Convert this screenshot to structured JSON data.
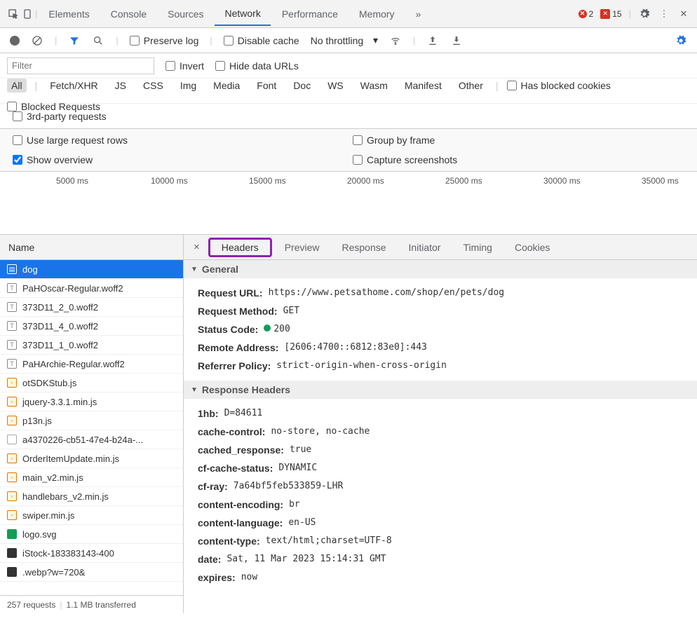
{
  "topTabs": {
    "elements": "Elements",
    "console": "Console",
    "sources": "Sources",
    "network": "Network",
    "performance": "Performance",
    "memory": "Memory"
  },
  "badges": {
    "err": "2",
    "warn": "15"
  },
  "toolbar": {
    "preserve": "Preserve log",
    "disable": "Disable cache",
    "throttle": "No throttling"
  },
  "filter": {
    "placeholder": "Filter",
    "invert": "Invert",
    "hideData": "Hide data URLs"
  },
  "types": {
    "all": "All",
    "fetch": "Fetch/XHR",
    "js": "JS",
    "css": "CSS",
    "img": "Img",
    "media": "Media",
    "font": "Font",
    "doc": "Doc",
    "ws": "WS",
    "wasm": "Wasm",
    "manifest": "Manifest",
    "other": "Other",
    "blocked": "Has blocked cookies",
    "blockedReq": "Blocked Requests"
  },
  "third": "3rd-party requests",
  "options": {
    "large": "Use large request rows",
    "group": "Group by frame",
    "overview": "Show overview",
    "capture": "Capture screenshots"
  },
  "timeline": [
    "5000 ms",
    "10000 ms",
    "15000 ms",
    "20000 ms",
    "25000 ms",
    "30000 ms",
    "35000 ms"
  ],
  "sidebar": {
    "header": "Name",
    "footer1": "257 requests",
    "footer2": "1.1 MB transferred",
    "items": [
      {
        "icon": "doc",
        "name": "dog",
        "sel": true
      },
      {
        "icon": "font",
        "name": "PaHOscar-Regular.woff2"
      },
      {
        "icon": "font",
        "name": "373D11_2_0.woff2"
      },
      {
        "icon": "font",
        "name": "373D11_4_0.woff2"
      },
      {
        "icon": "font",
        "name": "373D11_1_0.woff2"
      },
      {
        "icon": "font",
        "name": "PaHArchie-Regular.woff2"
      },
      {
        "icon": "js",
        "name": "otSDKStub.js"
      },
      {
        "icon": "js",
        "name": "jquery-3.3.1.min.js"
      },
      {
        "icon": "js",
        "name": "p13n.js"
      },
      {
        "icon": "blank",
        "name": "a4370226-cb51-47e4-b24a-..."
      },
      {
        "icon": "js",
        "name": "OrderItemUpdate.min.js"
      },
      {
        "icon": "js",
        "name": "main_v2.min.js"
      },
      {
        "icon": "js",
        "name": "handlebars_v2.min.js"
      },
      {
        "icon": "js",
        "name": "swiper.min.js"
      },
      {
        "icon": "img",
        "name": "logo.svg"
      },
      {
        "icon": "bin",
        "name": "iStock-183383143-400"
      },
      {
        "icon": "bin",
        "name": ".webp?w=720&"
      }
    ]
  },
  "detailTabs": {
    "headers": "Headers",
    "preview": "Preview",
    "response": "Response",
    "initiator": "Initiator",
    "timing": "Timing",
    "cookies": "Cookies"
  },
  "general": {
    "title": "General",
    "url_l": "Request URL:",
    "url_v": "https://www.petsathome.com/shop/en/pets/dog",
    "method_l": "Request Method:",
    "method_v": "GET",
    "status_l": "Status Code:",
    "status_v": "200",
    "remote_l": "Remote Address:",
    "remote_v": "[2606:4700::6812:83e0]:443",
    "ref_l": "Referrer Policy:",
    "ref_v": "strict-origin-when-cross-origin"
  },
  "response": {
    "title": "Response Headers",
    "h": [
      {
        "l": "1hb:",
        "v": "D=84611"
      },
      {
        "l": "cache-control:",
        "v": "no-store, no-cache"
      },
      {
        "l": "cached_response:",
        "v": "true"
      },
      {
        "l": "cf-cache-status:",
        "v": "DYNAMIC"
      },
      {
        "l": "cf-ray:",
        "v": "7a64bf5feb533859-LHR"
      },
      {
        "l": "content-encoding:",
        "v": "br"
      },
      {
        "l": "content-language:",
        "v": "en-US"
      },
      {
        "l": "content-type:",
        "v": "text/html;charset=UTF-8"
      },
      {
        "l": "date:",
        "v": "Sat, 11 Mar 2023 15:14:31 GMT"
      },
      {
        "l": "expires:",
        "v": "now"
      }
    ]
  }
}
